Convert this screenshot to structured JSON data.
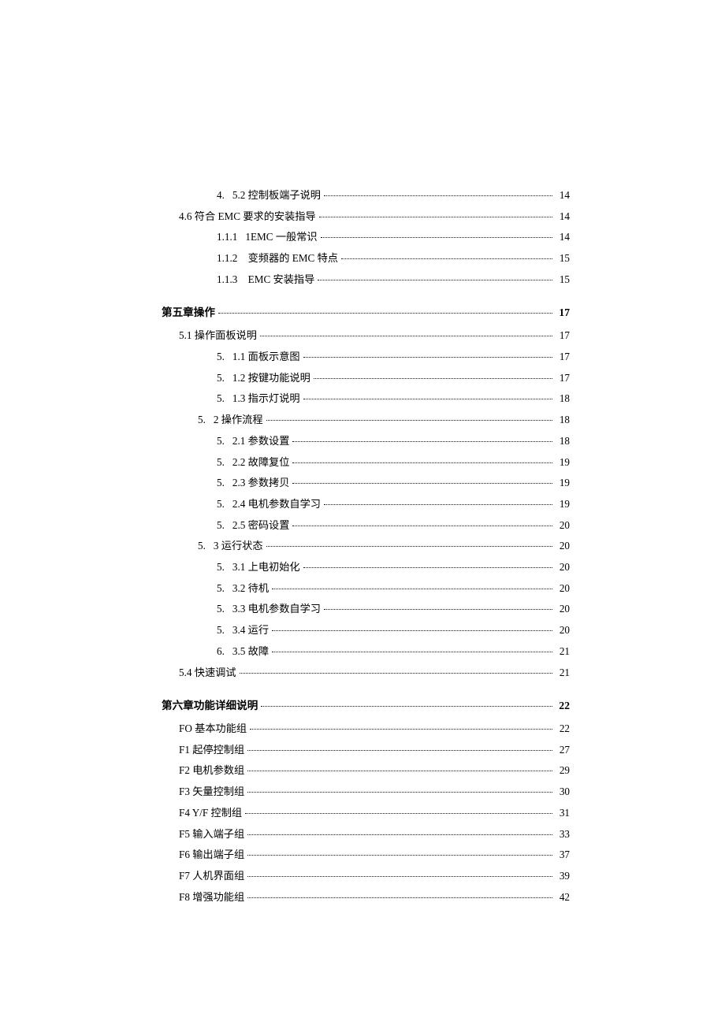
{
  "sections": [
    {
      "class": "lvl3",
      "pre": "4.",
      "title": "5.2 控制板端子说明",
      "page": "14"
    },
    {
      "class": "lvl1",
      "pre": "",
      "title": "4.6 符合 EMC 要求的安装指导",
      "page": "14"
    },
    {
      "class": "lvl3",
      "pre": "1.1.1",
      "title": "1EMC 一般常识",
      "page": "14"
    },
    {
      "class": "lvl3",
      "pre": "1.1.2",
      "title": "  变频器的 EMC 特点",
      "page": "15"
    },
    {
      "class": "lvl3",
      "pre": "1.1.3",
      "title": "  EMC 安装指导",
      "page": "15"
    },
    {
      "class": "chapter",
      "pre": "",
      "title": "第五章操作",
      "page": "17"
    },
    {
      "class": "lvl1",
      "pre": "",
      "title": "5.1 操作面板说明",
      "page": "17"
    },
    {
      "class": "lvl3",
      "pre": "5.",
      "title": "1.1 面板示意图",
      "page": "17"
    },
    {
      "class": "lvl3",
      "pre": "5.",
      "title": "1.2 按键功能说明",
      "page": "17"
    },
    {
      "class": "lvl3",
      "pre": "5.",
      "title": "1.3 指示灯说明",
      "page": "18"
    },
    {
      "class": "lvl2",
      "pre": "5.",
      "title": "2 操作流程",
      "page": "18"
    },
    {
      "class": "lvl3",
      "pre": "5.",
      "title": "2.1 参数设置",
      "page": "18"
    },
    {
      "class": "lvl3",
      "pre": "5.",
      "title": "2.2 故障复位",
      "page": "19"
    },
    {
      "class": "lvl3",
      "pre": "5.",
      "title": "2.3 参数拷贝",
      "page": "19"
    },
    {
      "class": "lvl3",
      "pre": "5.",
      "title": "2.4 电机参数自学习",
      "page": "19"
    },
    {
      "class": "lvl3",
      "pre": "5.",
      "title": "2.5 密码设置",
      "page": "20"
    },
    {
      "class": "lvl2",
      "pre": "5.",
      "title": "3 运行状态",
      "page": "20"
    },
    {
      "class": "lvl3",
      "pre": "5.",
      "title": "3.1 上电初始化",
      "page": "20"
    },
    {
      "class": "lvl3",
      "pre": "5.",
      "title": "3.2  待机",
      "page": "20"
    },
    {
      "class": "lvl3",
      "pre": "5.",
      "title": "3.3 电机参数自学习",
      "page": "20"
    },
    {
      "class": "lvl3",
      "pre": "5.",
      "title": "3.4  运行",
      "page": "20"
    },
    {
      "class": "lvl3",
      "pre": "6.",
      "title": "3.5  故障",
      "page": "21"
    },
    {
      "class": "lvl1",
      "pre": "",
      "title": "5.4 快速调试",
      "page": "21"
    },
    {
      "class": "chapter",
      "pre": "",
      "title": "第六章功能详细说明",
      "page": "22"
    },
    {
      "class": "lvl1",
      "pre": "",
      "title": "FO 基本功能组",
      "page": "22"
    },
    {
      "class": "lvl1",
      "pre": "",
      "title": "F1 起停控制组",
      "page": "27"
    },
    {
      "class": "lvl1",
      "pre": "",
      "title": "F2 电机参数组",
      "page": "29"
    },
    {
      "class": "lvl1",
      "pre": "",
      "title": "F3 矢量控制组",
      "page": "30"
    },
    {
      "class": "lvl1",
      "pre": "",
      "title": "F4   Y/F 控制组",
      "page": "31"
    },
    {
      "class": "lvl1",
      "pre": "",
      "title": "F5 输入端子组",
      "page": "33"
    },
    {
      "class": "lvl1",
      "pre": "",
      "title": "F6 输出端子组",
      "page": "37"
    },
    {
      "class": "lvl1",
      "pre": "",
      "title": "F7 人机界面组",
      "page": "39"
    },
    {
      "class": "lvl1",
      "pre": "",
      "title": "F8 增强功能组",
      "page": "42"
    }
  ]
}
